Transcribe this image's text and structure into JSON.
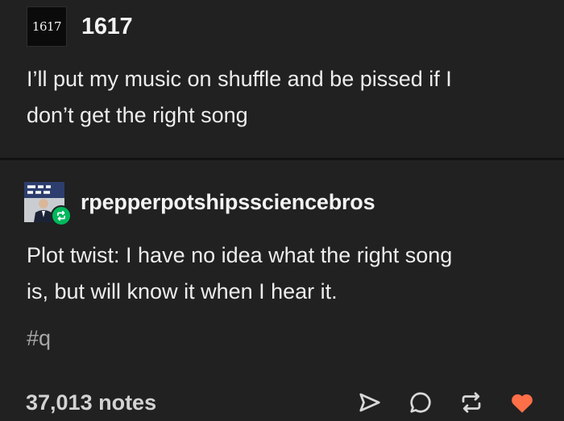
{
  "original_post": {
    "avatar_text": "1617",
    "username": "1617",
    "text_line1": "I’ll put my music on shuffle and be pissed if I",
    "text_line2": "don’t get the right song"
  },
  "reblog": {
    "username": "rpepperpotshipssciencebros",
    "text_line1": "Plot twist: I have no idea what the right song",
    "text_line2": "is, but will know it when I hear it.",
    "tag": "#q",
    "badge_color": "#00b85c"
  },
  "footer": {
    "notes": "37,013 notes",
    "like_color": "#ff6f48",
    "icons": [
      "share-icon",
      "reply-icon",
      "reblog-icon",
      "like-icon"
    ]
  }
}
